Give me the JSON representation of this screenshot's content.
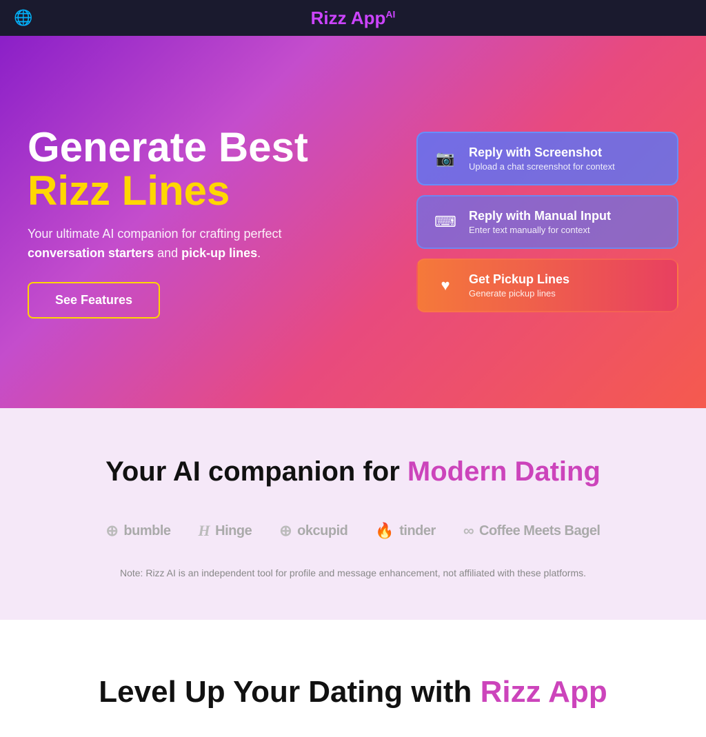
{
  "navbar": {
    "title_rizz": "Rizz App",
    "title_sup": "AI",
    "globe_icon": "🌐"
  },
  "hero": {
    "heading_line1": "Generate",
    "heading_line2": "Best",
    "heading_rizz_lines": "Rizz Lines",
    "description_prefix": "Your ultimate AI companion for crafting perfect ",
    "description_bold1": "conversation starters",
    "description_and": " and ",
    "description_bold2": "pick-up lines",
    "description_suffix": ".",
    "see_features_label": "See Features"
  },
  "action_buttons": {
    "screenshot": {
      "title": "Reply with Screenshot",
      "subtitle": "Upload a chat screenshot for context",
      "icon": "📷"
    },
    "manual": {
      "title": "Reply with Manual Input",
      "subtitle": "Enter text manually for context",
      "icon": "⌨"
    },
    "pickup": {
      "title": "Get Pickup Lines",
      "subtitle": "Generate pickup lines",
      "icon": "♥"
    }
  },
  "section2": {
    "title_plain": "Your AI companion for ",
    "title_colored": "Modern Dating",
    "platforms": [
      {
        "name": "bumble",
        "icon": "⊕"
      },
      {
        "name": "Hinge",
        "icon": "H"
      },
      {
        "name": "okcupid",
        "icon": "⊕"
      },
      {
        "name": "tinder",
        "icon": "🔥"
      },
      {
        "name": "Coffee Meets Bagel",
        "icon": "∞"
      }
    ],
    "note": "Note: Rizz AI is an independent tool for profile and message enhancement, not affiliated with these platforms."
  },
  "section3": {
    "title_plain": "Level Up Your Dating with ",
    "title_colored": "Rizz App"
  }
}
